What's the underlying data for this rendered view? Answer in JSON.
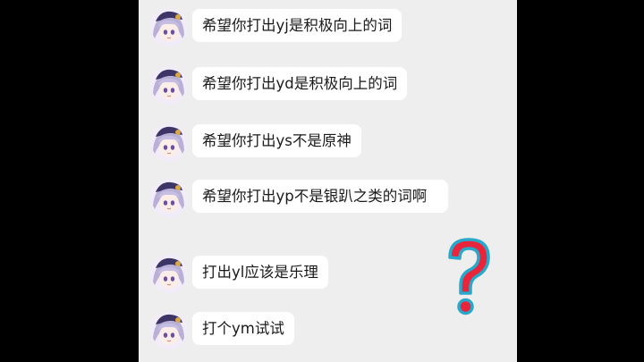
{
  "chat": {
    "messages": [
      {
        "text": "希望你打出yj是积极向上的词"
      },
      {
        "text": "希望你打出yd是积极向上的词"
      },
      {
        "text": "希望你打出ys不是原神"
      },
      {
        "text": "希望你打出yp不是银趴之类的词啊"
      },
      {
        "text": "打出yl应该是乐理"
      },
      {
        "text": "打个ym试试"
      }
    ]
  },
  "overlay": {
    "question_mark_icon": "question-mark-icon",
    "colors": {
      "fill": "#e8253a",
      "outline": "#29a8c9"
    }
  },
  "colors": {
    "letterbox": "#000000",
    "chat_background": "#eeeeee",
    "bubble": "#ffffff",
    "text": "#1a1a1a"
  }
}
